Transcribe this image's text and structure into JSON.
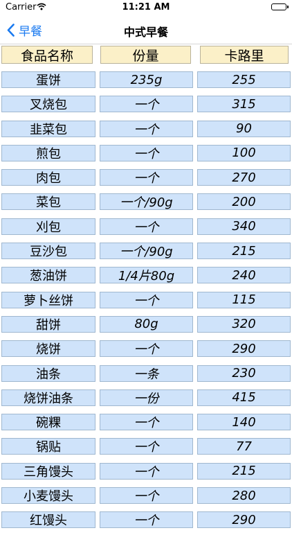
{
  "status_bar": {
    "carrier": "Carrier",
    "time": "11:21 AM"
  },
  "nav": {
    "back_label": "早餐",
    "title": "中式早餐"
  },
  "table": {
    "headers": [
      "食品名称",
      "份量",
      "卡路里"
    ],
    "rows": [
      {
        "name": "蛋饼",
        "portion": "235g",
        "calories": "255"
      },
      {
        "name": "叉烧包",
        "portion": "一个",
        "calories": "315"
      },
      {
        "name": "韭菜包",
        "portion": "一个",
        "calories": "90"
      },
      {
        "name": "煎包",
        "portion": "一个",
        "calories": "100"
      },
      {
        "name": "肉包",
        "portion": "一个",
        "calories": "270"
      },
      {
        "name": "菜包",
        "portion": "一个/90g",
        "calories": "200"
      },
      {
        "name": "刈包",
        "portion": "一个",
        "calories": "340"
      },
      {
        "name": "豆沙包",
        "portion": "一个/90g",
        "calories": "215"
      },
      {
        "name": "葱油饼",
        "portion": "1/4片80g",
        "calories": "240"
      },
      {
        "name": "萝卜丝饼",
        "portion": "一个",
        "calories": "115"
      },
      {
        "name": "甜饼",
        "portion": "80g",
        "calories": "320"
      },
      {
        "name": "烧饼",
        "portion": "一个",
        "calories": "290"
      },
      {
        "name": "油条",
        "portion": "一条",
        "calories": "230"
      },
      {
        "name": "烧饼油条",
        "portion": "一份",
        "calories": "415"
      },
      {
        "name": "碗粿",
        "portion": "一个",
        "calories": "140"
      },
      {
        "name": "锅贴",
        "portion": "一个",
        "calories": "77"
      },
      {
        "name": "三角馒头",
        "portion": "一个",
        "calories": "215"
      },
      {
        "name": "小麦馒头",
        "portion": "一个",
        "calories": "280"
      },
      {
        "name": "红馒头",
        "portion": "一个",
        "calories": "290"
      }
    ]
  }
}
